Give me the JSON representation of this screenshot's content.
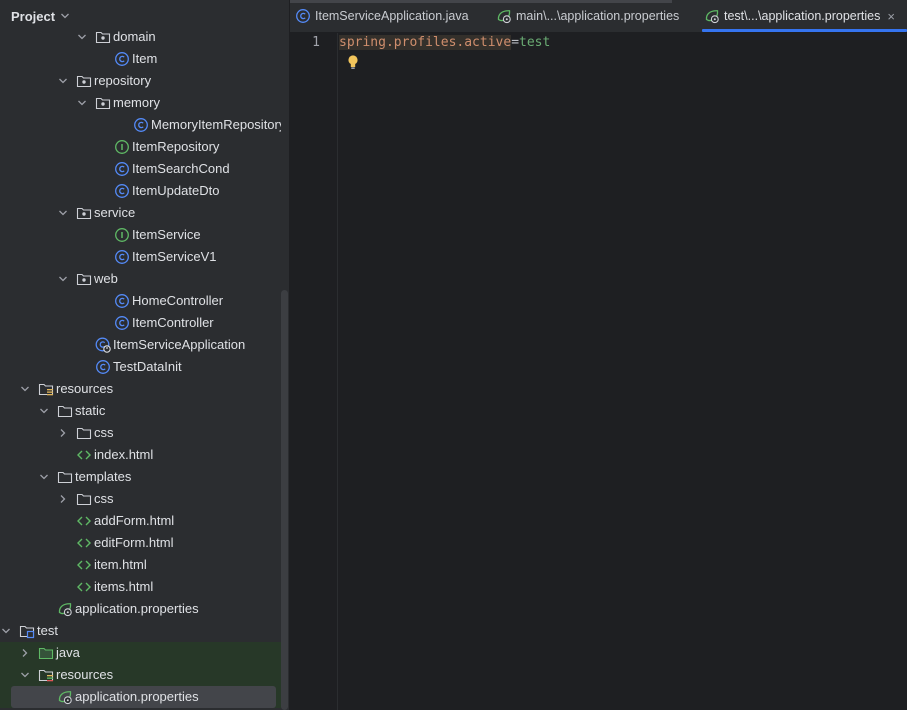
{
  "project_panel": {
    "title": "Project",
    "tree": [
      {
        "label": "domain",
        "icon": "package-folder-icon",
        "expand": "expanded"
      },
      {
        "label": "Item",
        "icon": "class-icon"
      },
      {
        "label": "repository",
        "icon": "package-folder-icon",
        "expand": "expanded"
      },
      {
        "label": "memory",
        "icon": "package-folder-icon",
        "expand": "expanded"
      },
      {
        "label": "MemoryItemRepository",
        "icon": "class-icon"
      },
      {
        "label": "ItemRepository",
        "icon": "interface-icon"
      },
      {
        "label": "ItemSearchCond",
        "icon": "class-icon"
      },
      {
        "label": "ItemUpdateDto",
        "icon": "class-icon"
      },
      {
        "label": "service",
        "icon": "package-folder-icon",
        "expand": "expanded"
      },
      {
        "label": "ItemService",
        "icon": "interface-icon"
      },
      {
        "label": "ItemServiceV1",
        "icon": "class-icon"
      },
      {
        "label": "web",
        "icon": "package-folder-icon",
        "expand": "expanded"
      },
      {
        "label": "HomeController",
        "icon": "class-icon"
      },
      {
        "label": "ItemController",
        "icon": "class-icon"
      },
      {
        "label": "ItemServiceApplication",
        "icon": "spring-boot-class-icon"
      },
      {
        "label": "TestDataInit",
        "icon": "class-icon"
      },
      {
        "label": "resources",
        "icon": "resources-folder-icon",
        "expand": "expanded"
      },
      {
        "label": "static",
        "icon": "folder-icon",
        "expand": "expanded"
      },
      {
        "label": "css",
        "icon": "folder-icon",
        "expand": "collapsed"
      },
      {
        "label": "index.html",
        "icon": "html-icon"
      },
      {
        "label": "templates",
        "icon": "folder-icon",
        "expand": "expanded"
      },
      {
        "label": "css",
        "icon": "folder-icon",
        "expand": "collapsed"
      },
      {
        "label": "addForm.html",
        "icon": "html-icon"
      },
      {
        "label": "editForm.html",
        "icon": "html-icon"
      },
      {
        "label": "item.html",
        "icon": "html-icon"
      },
      {
        "label": "items.html",
        "icon": "html-icon"
      },
      {
        "label": "application.properties",
        "icon": "spring-properties-icon"
      },
      {
        "label": "test",
        "icon": "test-folder-icon",
        "expand": "expanded"
      },
      {
        "label": "java",
        "icon": "test-source-folder-icon",
        "expand": "collapsed"
      },
      {
        "label": "resources",
        "icon": "test-resources-folder-icon",
        "expand": "expanded"
      },
      {
        "label": "application.properties",
        "icon": "spring-properties-icon",
        "selected": true
      }
    ]
  },
  "editor": {
    "tabs": [
      {
        "label": "ItemServiceApplication.java",
        "icon": "class-icon",
        "active": false
      },
      {
        "label": "main\\...\\application.properties",
        "icon": "spring-properties-icon",
        "active": false
      },
      {
        "label": "test\\...\\application.properties",
        "icon": "spring-properties-icon",
        "active": true,
        "close": "×"
      }
    ],
    "line_number": "1",
    "code": {
      "key": "spring.profiles.active",
      "eq": "=",
      "value": "test"
    }
  },
  "colors": {
    "class_icon": "#548af7",
    "interface_icon": "#5fb865",
    "html_icon": "#5fb865",
    "spring_icon": "#5fb865",
    "active_tab_underline": "#3574f0",
    "test_rows_bg": "#273828"
  }
}
